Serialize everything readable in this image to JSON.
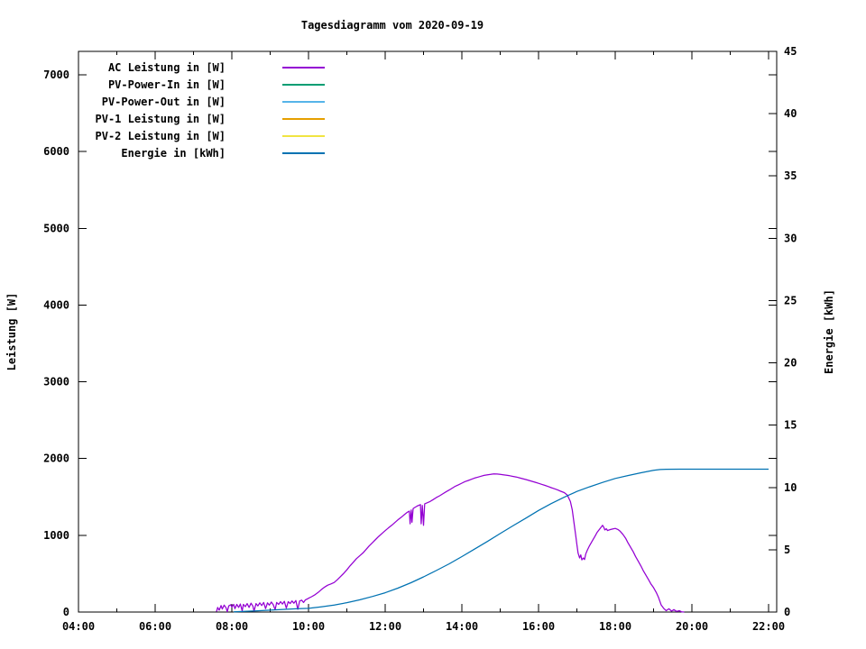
{
  "title": "Tagesdiagramm vom 2020-09-19",
  "chart_data": {
    "type": "line",
    "title": "Tagesdiagramm vom 2020-09-19",
    "x_axis": {
      "tick_labels": [
        "04:00",
        "06:00",
        "08:00",
        "10:00",
        "12:00",
        "14:00",
        "16:00",
        "18:00",
        "20:00",
        "22:00"
      ],
      "tick_hours": [
        4,
        6,
        8,
        10,
        12,
        14,
        16,
        18,
        20,
        22
      ],
      "minor_tick_hours": [
        5,
        7,
        9,
        11,
        13,
        15,
        17,
        19,
        21
      ],
      "range_hours": [
        4,
        22.2
      ],
      "grid": false
    },
    "y_left": {
      "label": "Leistung [W]",
      "ticks": [
        0,
        1000,
        2000,
        3000,
        4000,
        5000,
        6000,
        7000
      ],
      "range": [
        0,
        7300
      ]
    },
    "y_right": {
      "label": "Energie [kWh]",
      "ticks": [
        0,
        5,
        10,
        15,
        20,
        25,
        30,
        35,
        40,
        45
      ],
      "range": [
        0,
        45
      ]
    },
    "legend_position": "top-left-inside",
    "legend": [
      {
        "label": "AC Leistung in [W]",
        "color": "#9400d3"
      },
      {
        "label": "PV-Power-In in [W]",
        "color": "#009e73"
      },
      {
        "label": "PV-Power-Out in [W]",
        "color": "#56b4e9"
      },
      {
        "label": "PV-1 Leistung in [W]",
        "color": "#e69f00"
      },
      {
        "label": "PV-2 Leistung in [W]",
        "color": "#f0e442"
      },
      {
        "label": "Energie in [kWh]",
        "color": "#0072b2"
      }
    ],
    "series": [
      {
        "name": "AC Leistung in [W]",
        "color": "#9400d3",
        "axis": "left",
        "points": [
          [
            7.6,
            5
          ],
          [
            7.63,
            60
          ],
          [
            7.67,
            25
          ],
          [
            7.72,
            85
          ],
          [
            7.75,
            40
          ],
          [
            7.8,
            90
          ],
          [
            7.85,
            55
          ],
          [
            7.88,
            5
          ],
          [
            7.92,
            80
          ],
          [
            7.97,
            95
          ],
          [
            8.0,
            65
          ],
          [
            8.05,
            100
          ],
          [
            8.08,
            45
          ],
          [
            8.13,
            100
          ],
          [
            8.18,
            60
          ],
          [
            8.22,
            105
          ],
          [
            8.27,
            15
          ],
          [
            8.3,
            100
          ],
          [
            8.35,
            70
          ],
          [
            8.4,
            110
          ],
          [
            8.45,
            60
          ],
          [
            8.5,
            115
          ],
          [
            8.55,
            75
          ],
          [
            8.58,
            10
          ],
          [
            8.63,
            110
          ],
          [
            8.68,
            80
          ],
          [
            8.73,
            120
          ],
          [
            8.78,
            85
          ],
          [
            8.83,
            125
          ],
          [
            8.88,
            45
          ],
          [
            8.93,
            120
          ],
          [
            8.98,
            90
          ],
          [
            9.03,
            130
          ],
          [
            9.08,
            95
          ],
          [
            9.13,
            30
          ],
          [
            9.17,
            125
          ],
          [
            9.22,
            100
          ],
          [
            9.27,
            135
          ],
          [
            9.32,
            105
          ],
          [
            9.37,
            140
          ],
          [
            9.42,
            50
          ],
          [
            9.47,
            135
          ],
          [
            9.52,
            110
          ],
          [
            9.57,
            145
          ],
          [
            9.62,
            115
          ],
          [
            9.67,
            150
          ],
          [
            9.72,
            35
          ],
          [
            9.77,
            145
          ],
          [
            9.82,
            155
          ],
          [
            9.87,
            125
          ],
          [
            9.92,
            160
          ],
          [
            9.97,
            170
          ],
          [
            10.0,
            180
          ],
          [
            10.08,
            200
          ],
          [
            10.17,
            225
          ],
          [
            10.25,
            255
          ],
          [
            10.33,
            290
          ],
          [
            10.42,
            325
          ],
          [
            10.5,
            350
          ],
          [
            10.58,
            365
          ],
          [
            10.67,
            385
          ],
          [
            10.75,
            420
          ],
          [
            10.83,
            460
          ],
          [
            10.92,
            505
          ],
          [
            11.0,
            550
          ],
          [
            11.08,
            600
          ],
          [
            11.17,
            650
          ],
          [
            11.25,
            695
          ],
          [
            11.33,
            730
          ],
          [
            11.42,
            770
          ],
          [
            11.5,
            815
          ],
          [
            11.58,
            860
          ],
          [
            11.67,
            905
          ],
          [
            11.75,
            945
          ],
          [
            11.83,
            985
          ],
          [
            11.92,
            1025
          ],
          [
            12.0,
            1060
          ],
          [
            12.08,
            1095
          ],
          [
            12.17,
            1130
          ],
          [
            12.25,
            1165
          ],
          [
            12.33,
            1200
          ],
          [
            12.42,
            1235
          ],
          [
            12.5,
            1270
          ],
          [
            12.58,
            1300
          ],
          [
            12.63,
            1315
          ],
          [
            12.65,
            1150
          ],
          [
            12.68,
            1330
          ],
          [
            12.7,
            1170
          ],
          [
            12.73,
            1350
          ],
          [
            12.83,
            1380
          ],
          [
            12.92,
            1400
          ],
          [
            12.94,
            1150
          ],
          [
            12.97,
            1390
          ],
          [
            13.0,
            1130
          ],
          [
            13.03,
            1410
          ],
          [
            13.08,
            1420
          ],
          [
            13.17,
            1440
          ],
          [
            13.25,
            1465
          ],
          [
            13.33,
            1490
          ],
          [
            13.42,
            1515
          ],
          [
            13.5,
            1540
          ],
          [
            13.58,
            1565
          ],
          [
            13.67,
            1590
          ],
          [
            13.75,
            1615
          ],
          [
            13.83,
            1640
          ],
          [
            13.92,
            1660
          ],
          [
            14.0,
            1680
          ],
          [
            14.08,
            1700
          ],
          [
            14.17,
            1715
          ],
          [
            14.25,
            1730
          ],
          [
            14.33,
            1745
          ],
          [
            14.42,
            1758
          ],
          [
            14.5,
            1770
          ],
          [
            14.58,
            1780
          ],
          [
            14.67,
            1788
          ],
          [
            14.75,
            1794
          ],
          [
            14.83,
            1800
          ],
          [
            14.92,
            1798
          ],
          [
            15.0,
            1794
          ],
          [
            15.08,
            1789
          ],
          [
            15.17,
            1783
          ],
          [
            15.25,
            1776
          ],
          [
            15.33,
            1768
          ],
          [
            15.42,
            1759
          ],
          [
            15.5,
            1749
          ],
          [
            15.58,
            1738
          ],
          [
            15.67,
            1727
          ],
          [
            15.75,
            1715
          ],
          [
            15.83,
            1703
          ],
          [
            15.92,
            1690
          ],
          [
            16.0,
            1677
          ],
          [
            16.08,
            1664
          ],
          [
            16.17,
            1650
          ],
          [
            16.25,
            1636
          ],
          [
            16.33,
            1621
          ],
          [
            16.42,
            1606
          ],
          [
            16.5,
            1590
          ],
          [
            16.58,
            1574
          ],
          [
            16.67,
            1556
          ],
          [
            16.75,
            1525
          ],
          [
            16.83,
            1440
          ],
          [
            16.88,
            1330
          ],
          [
            16.92,
            1180
          ],
          [
            16.97,
            1000
          ],
          [
            17.0,
            880
          ],
          [
            17.03,
            770
          ],
          [
            17.07,
            705
          ],
          [
            17.1,
            745
          ],
          [
            17.13,
            680
          ],
          [
            17.17,
            705
          ],
          [
            17.2,
            685
          ],
          [
            17.23,
            755
          ],
          [
            17.27,
            805
          ],
          [
            17.33,
            865
          ],
          [
            17.4,
            925
          ],
          [
            17.47,
            985
          ],
          [
            17.53,
            1040
          ],
          [
            17.6,
            1085
          ],
          [
            17.67,
            1130
          ],
          [
            17.7,
            1105
          ],
          [
            17.73,
            1070
          ],
          [
            17.77,
            1085
          ],
          [
            17.8,
            1062
          ],
          [
            17.87,
            1075
          ],
          [
            17.93,
            1082
          ],
          [
            18.0,
            1090
          ],
          [
            18.07,
            1076
          ],
          [
            18.13,
            1052
          ],
          [
            18.2,
            1012
          ],
          [
            18.27,
            962
          ],
          [
            18.33,
            905
          ],
          [
            18.4,
            845
          ],
          [
            18.47,
            785
          ],
          [
            18.53,
            725
          ],
          [
            18.6,
            662
          ],
          [
            18.67,
            600
          ],
          [
            18.73,
            542
          ],
          [
            18.8,
            480
          ],
          [
            18.87,
            420
          ],
          [
            18.93,
            368
          ],
          [
            19.0,
            318
          ],
          [
            19.07,
            255
          ],
          [
            19.13,
            190
          ],
          [
            19.2,
            90
          ],
          [
            19.27,
            45
          ],
          [
            19.33,
            18
          ],
          [
            19.4,
            42
          ],
          [
            19.47,
            12
          ],
          [
            19.53,
            32
          ],
          [
            19.6,
            8
          ],
          [
            19.67,
            18
          ],
          [
            19.73,
            4
          ],
          [
            19.8,
            0
          ]
        ]
      },
      {
        "name": "PV-Power-In in [W]",
        "color": "#009e73",
        "axis": "left",
        "points": []
      },
      {
        "name": "PV-Power-Out in [W]",
        "color": "#56b4e9",
        "axis": "left",
        "points": []
      },
      {
        "name": "PV-1 Leistung in [W]",
        "color": "#e69f00",
        "axis": "left",
        "points": []
      },
      {
        "name": "PV-2 Leistung in [W]",
        "color": "#f0e442",
        "axis": "left",
        "points": []
      },
      {
        "name": "Energie in [kWh]",
        "color": "#0072b2",
        "axis": "right",
        "points": [
          [
            8.05,
            0.02
          ],
          [
            8.33,
            0.05
          ],
          [
            8.67,
            0.1
          ],
          [
            9.0,
            0.15
          ],
          [
            9.33,
            0.21
          ],
          [
            9.67,
            0.26
          ],
          [
            10.0,
            0.3
          ],
          [
            10.33,
            0.42
          ],
          [
            10.67,
            0.56
          ],
          [
            11.0,
            0.75
          ],
          [
            11.33,
            0.98
          ],
          [
            11.67,
            1.25
          ],
          [
            12.0,
            1.55
          ],
          [
            12.33,
            1.92
          ],
          [
            12.67,
            2.35
          ],
          [
            13.0,
            2.82
          ],
          [
            13.33,
            3.33
          ],
          [
            13.67,
            3.87
          ],
          [
            14.0,
            4.45
          ],
          [
            14.33,
            5.05
          ],
          [
            14.67,
            5.67
          ],
          [
            15.0,
            6.3
          ],
          [
            15.33,
            6.92
          ],
          [
            15.67,
            7.54
          ],
          [
            16.0,
            8.15
          ],
          [
            16.33,
            8.7
          ],
          [
            16.67,
            9.22
          ],
          [
            17.0,
            9.68
          ],
          [
            17.33,
            10.05
          ],
          [
            17.67,
            10.4
          ],
          [
            18.0,
            10.72
          ],
          [
            18.33,
            10.95
          ],
          [
            18.67,
            11.18
          ],
          [
            19.0,
            11.38
          ],
          [
            19.17,
            11.44
          ],
          [
            19.33,
            11.46
          ],
          [
            19.67,
            11.47
          ],
          [
            20.0,
            11.47
          ],
          [
            21.0,
            11.47
          ],
          [
            22.0,
            11.47
          ]
        ]
      }
    ],
    "notes": "Only 'AC Leistung' and 'Energie' curves are visible; the other four legend series show no data."
  }
}
